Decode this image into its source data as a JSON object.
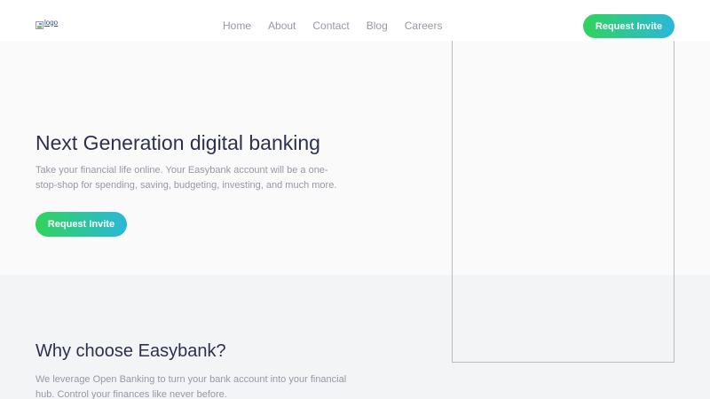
{
  "header": {
    "logo_alt": "logo",
    "nav": [
      "Home",
      "About",
      "Contact",
      "Blog",
      "Careers"
    ],
    "cta_label": "Request Invite"
  },
  "hero": {
    "title": "Next Generation digital banking",
    "text": "Take your financial life online. Your Easybank account will be a one-stop-shop for spending, saving, budgeting, investing, and much more.",
    "cta_label": "Request Invite"
  },
  "features": {
    "title": "Why choose Easybank?",
    "text": "We leverage Open Banking to turn your bank account into your financial hub. Control your finances like never before."
  },
  "colors": {
    "accent_start": "#31d35c",
    "accent_end": "#2bb7da",
    "heading": "#2d314d",
    "body_text": "#9698a6"
  }
}
